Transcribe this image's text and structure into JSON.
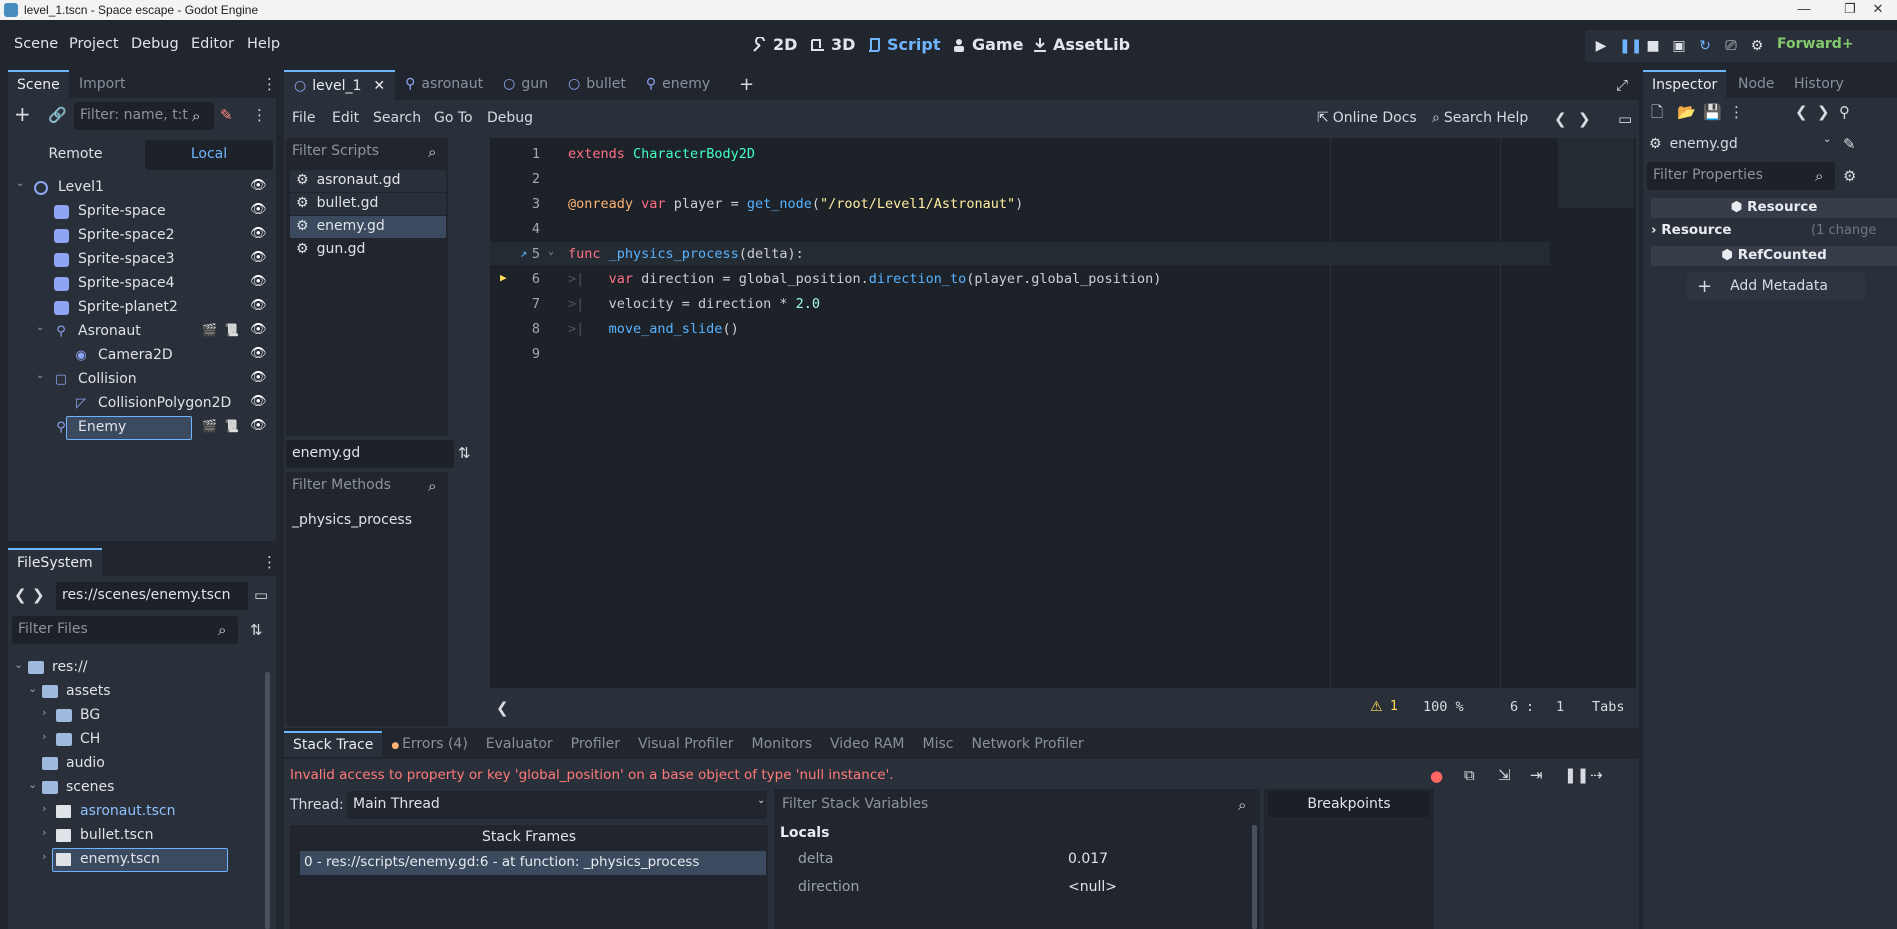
{
  "window": {
    "title": "level_1.tscn - Space escape - Godot Engine",
    "minimize": "—",
    "maximize": "❐",
    "close": "✕"
  },
  "menu": [
    "Scene",
    "Project",
    "Debug",
    "Editor",
    "Help"
  ],
  "workspaces": [
    {
      "label": "2D",
      "active": false
    },
    {
      "label": "3D",
      "active": false
    },
    {
      "label": "Script",
      "active": true
    },
    {
      "label": "Game",
      "active": false
    },
    {
      "label": "AssetLib",
      "active": false
    }
  ],
  "renderer": "Forward+",
  "scene_dock": {
    "tabs": [
      "Scene",
      "Import"
    ],
    "filter_placeholder": "Filter: name, t:t",
    "remote": "Remote",
    "local": "Local",
    "nodes": [
      {
        "label": "Level1",
        "depth": 0,
        "icon": "node2d-icon"
      },
      {
        "label": "Sprite-space",
        "depth": 1,
        "icon": "sprite-icon"
      },
      {
        "label": "Sprite-space2",
        "depth": 1,
        "icon": "sprite-icon"
      },
      {
        "label": "Sprite-space3",
        "depth": 1,
        "icon": "sprite-icon"
      },
      {
        "label": "Sprite-space4",
        "depth": 1,
        "icon": "sprite-icon"
      },
      {
        "label": "Sprite-planet2",
        "depth": 1,
        "icon": "sprite-icon"
      },
      {
        "label": "Asronaut",
        "depth": 1,
        "icon": "character-icon",
        "extras": true
      },
      {
        "label": "Camera2D",
        "depth": 2,
        "icon": "camera-icon"
      },
      {
        "label": "Collision",
        "depth": 1,
        "icon": "collision-icon"
      },
      {
        "label": "CollisionPolygon2D",
        "depth": 2,
        "icon": "polygon-icon"
      },
      {
        "label": "Enemy",
        "depth": 1,
        "icon": "character-icon",
        "extras": true,
        "selected": true
      }
    ]
  },
  "filesystem": {
    "tab": "FileSystem",
    "path": "res://scenes/enemy.tscn",
    "filter_placeholder": "Filter Files",
    "items": [
      {
        "label": "res://",
        "depth": 0,
        "type": "folder",
        "arrow": "open"
      },
      {
        "label": "assets",
        "depth": 1,
        "type": "folder",
        "arrow": "open"
      },
      {
        "label": "BG",
        "depth": 2,
        "type": "folder",
        "arrow": "closed"
      },
      {
        "label": "CH",
        "depth": 2,
        "type": "folder",
        "arrow": "closed"
      },
      {
        "label": "audio",
        "depth": 1,
        "type": "folder",
        "arrow": "none"
      },
      {
        "label": "scenes",
        "depth": 1,
        "type": "folder",
        "arrow": "open"
      },
      {
        "label": "asronaut.tscn",
        "depth": 2,
        "type": "scene",
        "highlight": true
      },
      {
        "label": "bullet.tscn",
        "depth": 2,
        "type": "scene"
      },
      {
        "label": "enemy.tscn",
        "depth": 2,
        "type": "scene",
        "selected": true
      }
    ]
  },
  "scene_tabs": [
    {
      "label": "level_1",
      "active": true,
      "close": "✕"
    },
    {
      "label": "asronaut",
      "active": false
    },
    {
      "label": "gun",
      "active": false
    },
    {
      "label": "bullet",
      "active": false
    },
    {
      "label": "enemy",
      "active": false
    }
  ],
  "script_menu": [
    "File",
    "Edit",
    "Search",
    "Go To",
    "Debug"
  ],
  "online_docs": "Online Docs",
  "search_help": "Search Help",
  "scripts": {
    "filter_placeholder": "Filter Scripts",
    "items": [
      {
        "label": "asronaut.gd",
        "active": false
      },
      {
        "label": "bullet.gd",
        "active": false
      },
      {
        "label": "enemy.gd",
        "active": true
      },
      {
        "label": "gun.gd",
        "active": false
      }
    ],
    "current": "enemy.gd",
    "methods_placeholder": "Filter Methods",
    "methods": [
      "_physics_process"
    ]
  },
  "code": {
    "lines": [
      "1",
      "2",
      "3",
      "4",
      "5",
      "6",
      "7",
      "8",
      "9"
    ],
    "l1": [
      "extends",
      " ",
      "CharacterBody2D"
    ],
    "l3": [
      "@onready",
      " ",
      "var",
      " player = ",
      "get_node",
      "(",
      "\"/root/Level1/Astronaut\"",
      ")"
    ],
    "l5": [
      "func",
      " ",
      "_physics_process",
      "(delta):"
    ],
    "l6": [
      "var",
      " direction = global_position.",
      "direction_to",
      "(player.global_position)"
    ],
    "l7": [
      "velocity = direction * ",
      "2.0"
    ],
    "l8": [
      "move_and_slide",
      "()"
    ]
  },
  "status": {
    "warnings": "1",
    "zoom": "100 %",
    "line": "6",
    "sep": ":",
    "col": "1",
    "indent": "Tabs"
  },
  "bottom_tabs": [
    "Stack Trace",
    "Errors (4)",
    "Evaluator",
    "Profiler",
    "Visual Profiler",
    "Monitors",
    "Video RAM",
    "Misc",
    "Network Profiler"
  ],
  "debugger": {
    "error": "Invalid access to property or key 'global_position' on a base object of type 'null instance'.",
    "thread_label": "Thread:",
    "thread": "Main Thread",
    "stack_frames_header": "Stack Frames",
    "frames": [
      "0 - res://scripts/enemy.gd:6 - at function: _physics_process"
    ],
    "filter_vars_placeholder": "Filter Stack Variables",
    "locals_header": "Locals",
    "locals": [
      {
        "name": "delta",
        "value": "0.017"
      },
      {
        "name": "direction",
        "value": "<null>"
      }
    ],
    "breakpoints": "Breakpoints"
  },
  "inspector": {
    "tabs": [
      "Inspector",
      "Node",
      "History"
    ],
    "resource_name": "enemy.gd",
    "filter_placeholder": "Filter Properties",
    "section_resource": "Resource",
    "prop_resource": "Resource",
    "prop_resource_note": "(1 change",
    "section_refcounted": "RefCounted",
    "add_metadata": "Add Metadata"
  },
  "colors": {
    "accent": "#6fb4ff",
    "error": "#ff7a7a",
    "base": "#21262e",
    "panel": "#2a3039"
  }
}
